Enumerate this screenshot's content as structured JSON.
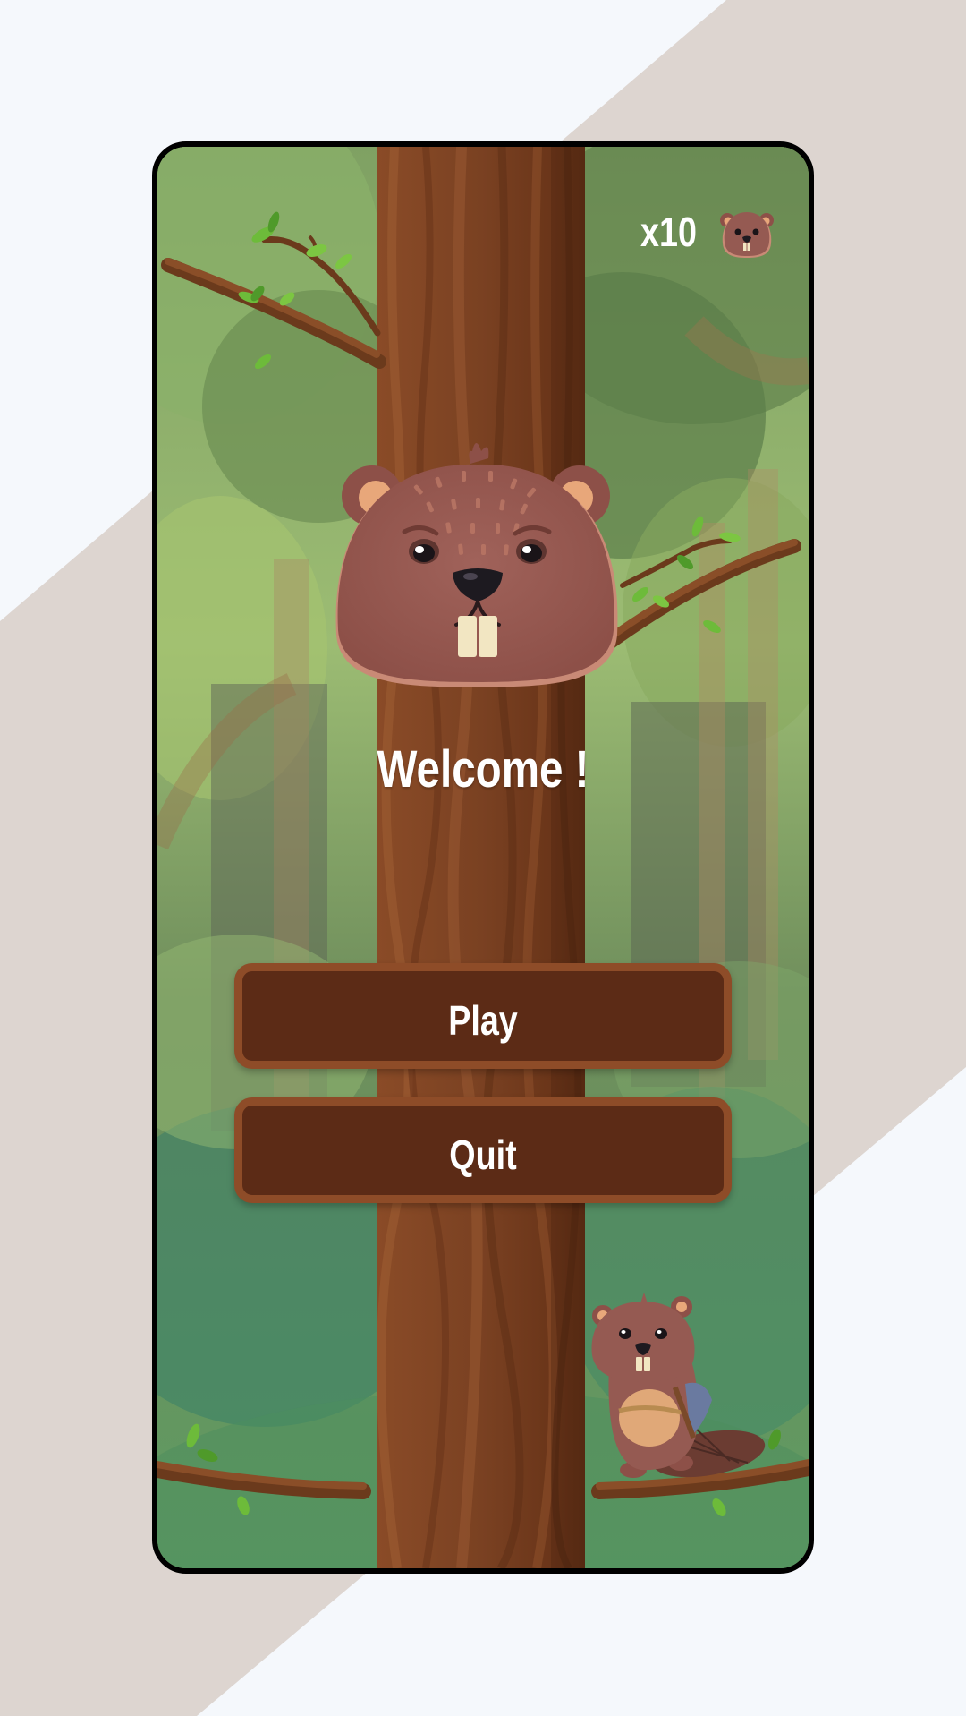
{
  "hud": {
    "lives_count": "x10",
    "lives_icon": "beaver-head-icon"
  },
  "menu": {
    "title": "Welcome !",
    "play_label": "Play",
    "quit_label": "Quit"
  },
  "colors": {
    "page_background": "#f5f8fc",
    "diagonal_band": "#ddd5d0",
    "button_fill": "#5c2b16",
    "button_border": "#8e4c28",
    "trunk": "#7d4424",
    "beaver_fur": "#955a52",
    "text": "#ffffff"
  }
}
